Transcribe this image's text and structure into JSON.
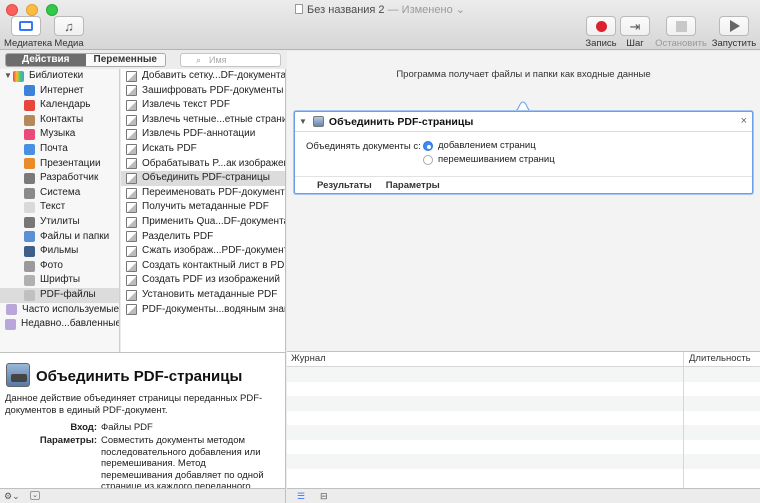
{
  "window": {
    "title": "Без названия 2",
    "status": "— Изменено ⌄"
  },
  "toolbar": {
    "library_label": "Медиатека",
    "media_label": "Медиа",
    "record_label": "Запись",
    "step_label": "Шаг",
    "stop_label": "Остановить",
    "run_label": "Запустить"
  },
  "tabs": {
    "actions": "Действия",
    "variables": "Переменные"
  },
  "search": {
    "placeholder": "Имя"
  },
  "library": {
    "root": "Библиотеки",
    "items": [
      {
        "label": "Интернет",
        "color": "#3b82d8"
      },
      {
        "label": "Календарь",
        "color": "#e8463c"
      },
      {
        "label": "Контакты",
        "color": "#b58a5a"
      },
      {
        "label": "Музыка",
        "color": "#e94a7a"
      },
      {
        "label": "Почта",
        "color": "#4a90e2"
      },
      {
        "label": "Презентации",
        "color": "#e98a2b"
      },
      {
        "label": "Разработчик",
        "color": "#7a7a7a"
      },
      {
        "label": "Система",
        "color": "#8a8a8a"
      },
      {
        "label": "Текст",
        "color": "#d9d9d9"
      },
      {
        "label": "Утилиты",
        "color": "#777777"
      },
      {
        "label": "Файлы и папки",
        "color": "#5a8fd6"
      },
      {
        "label": "Фильмы",
        "color": "#3d5f8a"
      },
      {
        "label": "Фото",
        "color": "#9a9a9a"
      },
      {
        "label": "Шрифты",
        "color": "#b0b0b0"
      },
      {
        "label": "PDF-файлы",
        "color": "#c0c0c0"
      }
    ],
    "recent": "Часто используемые",
    "added": "Недавно...бавленные"
  },
  "actions": [
    "Добавить сетку...DF-документам",
    "Зашифровать PDF-документы",
    "Извлечь текст PDF",
    "Извлечь четные...етные страницы",
    "Извлечь PDF-аннотации",
    "Искать PDF",
    "Обрабатывать P...ак изображения",
    "Объединить PDF-страницы",
    "Переименовать PDF-документы",
    "Получить метаданные PDF",
    "Применить Qua...DF-документам",
    "Разделить PDF",
    "Сжать изображ...PDF-документах",
    "Создать контактный лист в PDF",
    "Создать PDF из изображений",
    "Установить метаданные PDF",
    "PDF-документы...водяным знаком"
  ],
  "description": {
    "title": "Объединить PDF-страницы",
    "text": "Данное действие объединяет страницы переданных PDF-документов в единый PDF-документ.",
    "input_key": "Вход:",
    "input_value": "Файлы PDF",
    "params_key": "Параметры:",
    "params_value": "Совместить документы методом последовательного добавления или перемешивания. Метод перемешивания добавляет по одной странице из каждого переданного"
  },
  "workflow": {
    "hint": "Программа получает файлы и папки как входные данные",
    "action_title": "Объединить PDF-страницы",
    "combine_label": "Объединять документы с:",
    "option_append": "добавлением страниц",
    "option_shuffle": "перемешиванием страниц",
    "results_tab": "Результаты",
    "options_tab": "Параметры"
  },
  "log": {
    "col_log": "Журнал",
    "col_duration": "Длительность"
  }
}
